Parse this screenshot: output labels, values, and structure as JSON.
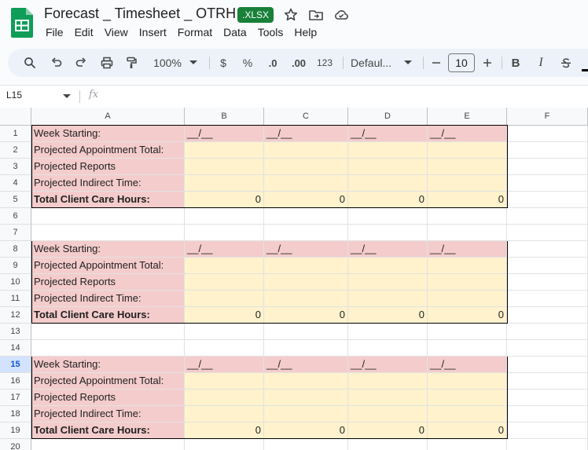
{
  "doc": {
    "title": "Forecast _ Timesheet _ OTRH",
    "badge": ".XLSX",
    "icons": [
      "star-icon",
      "move-to-folder-icon",
      "cloud-status-icon"
    ]
  },
  "menu": [
    "File",
    "Edit",
    "View",
    "Insert",
    "Format",
    "Data",
    "Tools",
    "Help"
  ],
  "toolbar": {
    "zoom": "100%",
    "currency": "$",
    "percent": "%",
    "dec_decrease": ".0",
    "dec_increase": ".00",
    "number_format": "123",
    "font": "Defaul...",
    "font_size": "10",
    "bold": "B",
    "italic": "I"
  },
  "formula_bar": {
    "name_box": "L15",
    "fx": "fx",
    "value": ""
  },
  "columns": [
    "A",
    "B",
    "C",
    "D",
    "E",
    "F"
  ],
  "rows": [
    "1",
    "2",
    "3",
    "4",
    "5",
    "6",
    "7",
    "8",
    "9",
    "10",
    "11",
    "12",
    "13",
    "14",
    "15",
    "16",
    "17",
    "18",
    "19",
    "20"
  ],
  "selected_row": "15",
  "blocks": [
    {
      "labels": [
        "Week Starting:",
        "Projected Appointment Total:",
        "Projected Reports",
        "Projected Indirect Time:",
        "Total Client Care Hours:"
      ],
      "week_values": [
        "__/__",
        "__/__",
        "__/__",
        "__/__"
      ],
      "totals": [
        "0",
        "0",
        "0",
        "0"
      ]
    },
    {
      "labels": [
        "Week Starting:",
        "Projected Appointment Total:",
        "Projected Reports",
        "Projected Indirect Time:",
        "Total Client Care Hours:"
      ],
      "week_values": [
        "__/__",
        "__/__",
        "__/__",
        "__/__"
      ],
      "totals": [
        "0",
        "0",
        "0",
        "0"
      ]
    },
    {
      "labels": [
        "Week Starting:",
        "Projected Appointment Total:",
        "Projected Reports",
        "Projected Indirect Time:",
        "Total Client Care Hours:"
      ],
      "week_values": [
        "__/__",
        "__/__",
        "__/__",
        "__/__"
      ],
      "totals": [
        "0",
        "0",
        "0",
        "0"
      ]
    }
  ],
  "colors": {
    "label_fill": "#f4cccc",
    "input_fill": "#fff2cc",
    "badge": "#188038",
    "selection": "#d3e3fd"
  }
}
